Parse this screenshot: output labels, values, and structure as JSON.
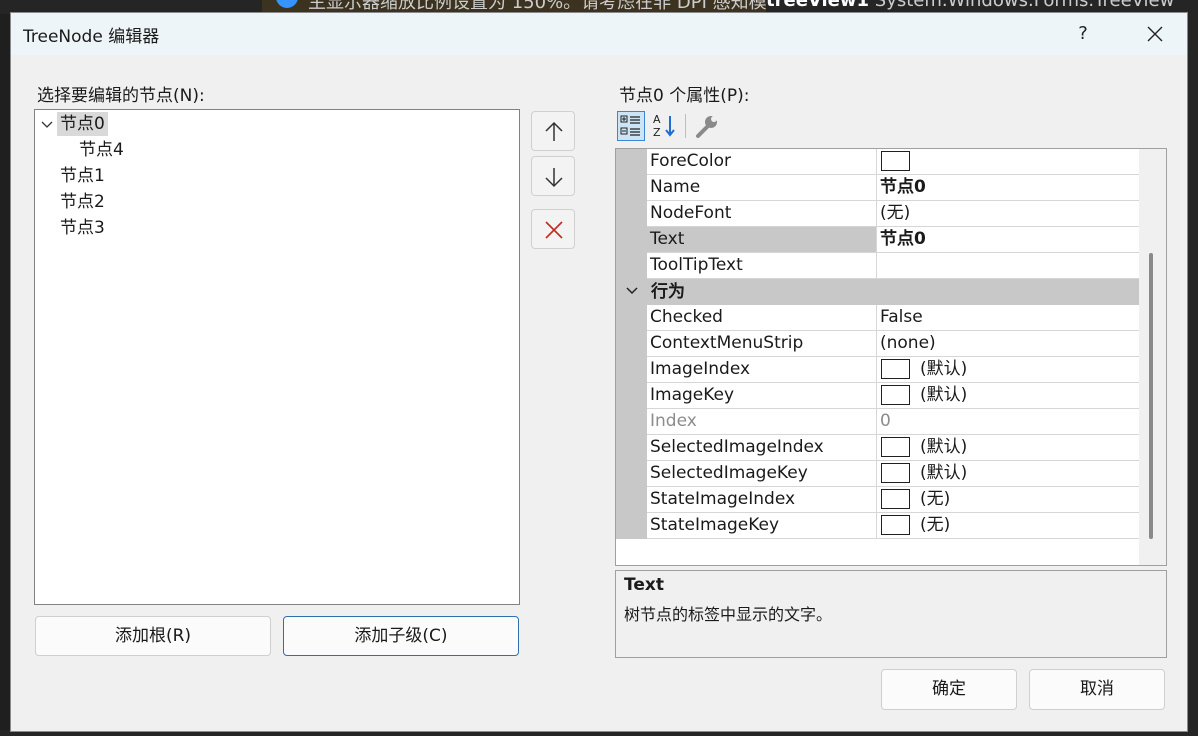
{
  "background": {
    "info_text": "主显示器缩放比例设置为 150%。请考虑在非 DPI 感知模",
    "component_name": "treeView1",
    "component_type": "System.Windows.Forms.TreeView"
  },
  "window": {
    "title": "TreeNode 编辑器",
    "help_label": "?"
  },
  "tree": {
    "label": "选择要编辑的节点(N):",
    "nodes": [
      "节点0",
      "节点4",
      "节点1",
      "节点2",
      "节点3"
    ]
  },
  "buttons": {
    "add_root": "添加根(R)",
    "add_child": "添加子级(C)",
    "ok": "确定",
    "cancel": "取消"
  },
  "properties": {
    "label": "节点0 个属性(P):",
    "rows": [
      {
        "name": "ForeColor",
        "value": ""
      },
      {
        "name": "Name",
        "value": "节点0"
      },
      {
        "name": "NodeFont",
        "value": "(无)"
      },
      {
        "name": "Text",
        "value": "节点0"
      },
      {
        "name": "ToolTipText",
        "value": ""
      }
    ],
    "category": "行为",
    "behavior_rows": [
      {
        "name": "Checked",
        "value": "False"
      },
      {
        "name": "ContextMenuStrip",
        "value": "(none)"
      },
      {
        "name": "ImageIndex",
        "value": "(默认)"
      },
      {
        "name": "ImageKey",
        "value": "(默认)"
      },
      {
        "name": "Index",
        "value": "0"
      },
      {
        "name": "SelectedImageIndex",
        "value": "(默认)"
      },
      {
        "name": "SelectedImageKey",
        "value": "(默认)"
      },
      {
        "name": "StateImageIndex",
        "value": "(无)"
      },
      {
        "name": "StateImageKey",
        "value": "(无)"
      }
    ]
  },
  "description": {
    "title": "Text",
    "text": "树节点的标签中显示的文字。"
  },
  "colors": {
    "accent": "#2f6fb0",
    "delete_red": "#c42b1c",
    "selected_gray": "#c8c8c8"
  }
}
